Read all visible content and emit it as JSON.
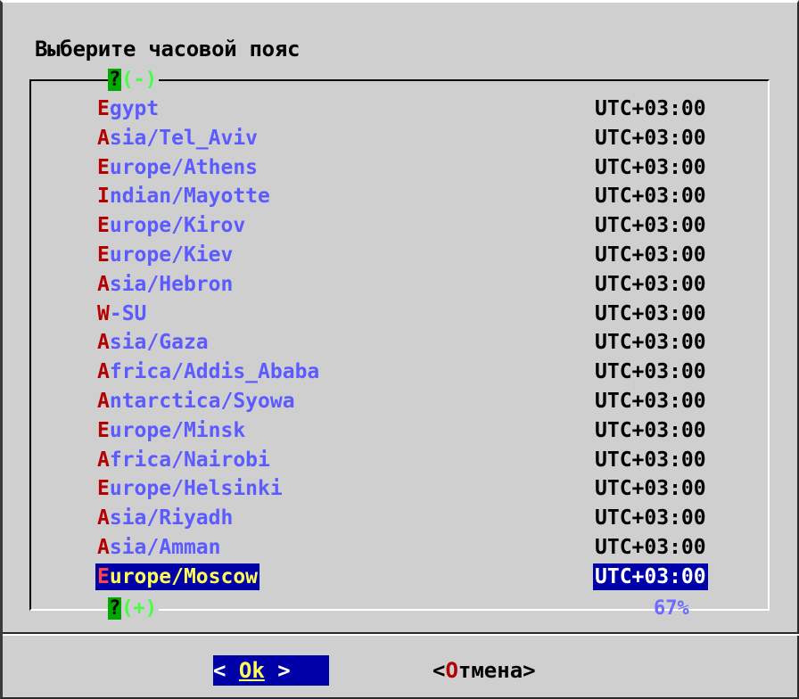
{
  "dialog": {
    "title": "Выберите часовой пояс",
    "scroll_up": {
      "q": "?",
      "mark": "(-)"
    },
    "scroll_down": {
      "q": "?",
      "mark": "(+)"
    },
    "percent": "67%"
  },
  "timezones": [
    {
      "hk": "E",
      "rest": "gypt",
      "offset": "UTC+03:00"
    },
    {
      "hk": "A",
      "rest": "sia/Tel_Aviv",
      "offset": "UTC+03:00"
    },
    {
      "hk": "E",
      "rest": "urope/Athens",
      "offset": "UTC+03:00"
    },
    {
      "hk": "I",
      "rest": "ndian/Mayotte",
      "offset": "UTC+03:00"
    },
    {
      "hk": "E",
      "rest": "urope/Kirov",
      "offset": "UTC+03:00"
    },
    {
      "hk": "E",
      "rest": "urope/Kiev",
      "offset": "UTC+03:00"
    },
    {
      "hk": "A",
      "rest": "sia/Hebron",
      "offset": "UTC+03:00"
    },
    {
      "hk": "W",
      "rest": "-SU",
      "offset": "UTC+03:00"
    },
    {
      "hk": "A",
      "rest": "sia/Gaza",
      "offset": "UTC+03:00"
    },
    {
      "hk": "A",
      "rest": "frica/Addis_Ababa",
      "offset": "UTC+03:00"
    },
    {
      "hk": "A",
      "rest": "ntarctica/Syowa",
      "offset": "UTC+03:00"
    },
    {
      "hk": "E",
      "rest": "urope/Minsk",
      "offset": "UTC+03:00"
    },
    {
      "hk": "A",
      "rest": "frica/Nairobi",
      "offset": "UTC+03:00"
    },
    {
      "hk": "E",
      "rest": "urope/Helsinki",
      "offset": "UTC+03:00"
    },
    {
      "hk": "A",
      "rest": "sia/Riyadh",
      "offset": "UTC+03:00"
    },
    {
      "hk": "A",
      "rest": "sia/Amman",
      "offset": "UTC+03:00"
    },
    {
      "hk": "E",
      "rest": "urope/Moscow",
      "offset": "UTC+03:00",
      "selected": true
    }
  ],
  "buttons": {
    "ok": {
      "left": "< ",
      "label": "Ok",
      "right": " >"
    },
    "cancel": {
      "open": "<",
      "hk": "О",
      "rest": "тмена",
      "close": ">"
    }
  },
  "colors": {
    "dialog_bg": "#cfcfcf",
    "item_text": "#5b5bff",
    "hotkey": "#b30000",
    "selection_bg": "#0000a8",
    "selection_text": "#ffff55"
  }
}
